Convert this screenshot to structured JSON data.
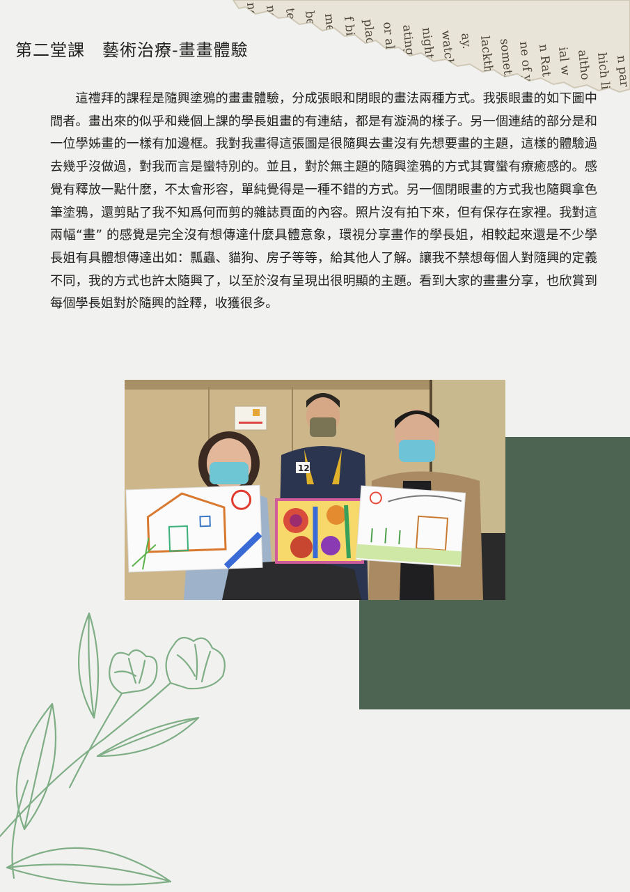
{
  "page": {
    "title": "第二堂課　藝術治療-畫畫體驗",
    "paragraph": "這禮拜的課程是隨興塗鴉的畫畫體驗，分成張眼和閉眼的畫法兩種方式。我張眼畫的如下圖中間者。畫出來的似乎和幾個上課的學長姐畫的有連結，都是有漩渦的樣子。另一個連結的部分是和一位學姊畫的一樣有加邊框。我對我畫得這張圖是很隨興去畫沒有先想要畫的主題，這樣的體驗過去幾乎沒做過，對我而言是蠻特別的。並且，對於無主題的隨興塗鴉的方式其實蠻有療癒感的。感覺有釋放一點什麼，不太會形容，單純覺得是一種不錯的方式。另一個閉眼畫的方式我也隨興拿色筆塗鴉，還剪貼了我不知爲何而剪的雜誌頁面的內容。照片沒有拍下來，但有保存在家裡。我對這兩幅“畫” 的感覺是完全沒有想傳達什麼具體意象，環視分享畫作的學長姐，相較起來還是不少學長姐有具體想傳達出如：瓢蟲、貓狗、房子等等，給其他人了解。讓我不禁想每個人對隨興的定義不同，我的方式也許太隨興了，以至於沒有呈現出很明顯的主題。看到大家的畫畫分享，也欣賞到每個學長姐對於隨興的詮釋，收獲很多。"
  },
  "photo": {
    "vest_number": "12"
  },
  "torn_paper_words": [
    "ned",
    "ng c",
    "tensic",
    "berwe",
    "me ye",
    "f big-c",
    "placi",
    "or all i",
    "ating,",
    "night ti",
    "watch ti",
    "ay.",
    "lackth",
    "somethi",
    "ne of ye",
    "n Rat",
    "ial w",
    "altho",
    "hich li",
    "n par"
  ],
  "colors": {
    "background": "#f1f1ef",
    "green_block": "#4d6453",
    "flower_line": "#7fae86",
    "text": "#222222"
  },
  "icons": [
    "flower-line-art",
    "torn-newspaper-strip"
  ]
}
